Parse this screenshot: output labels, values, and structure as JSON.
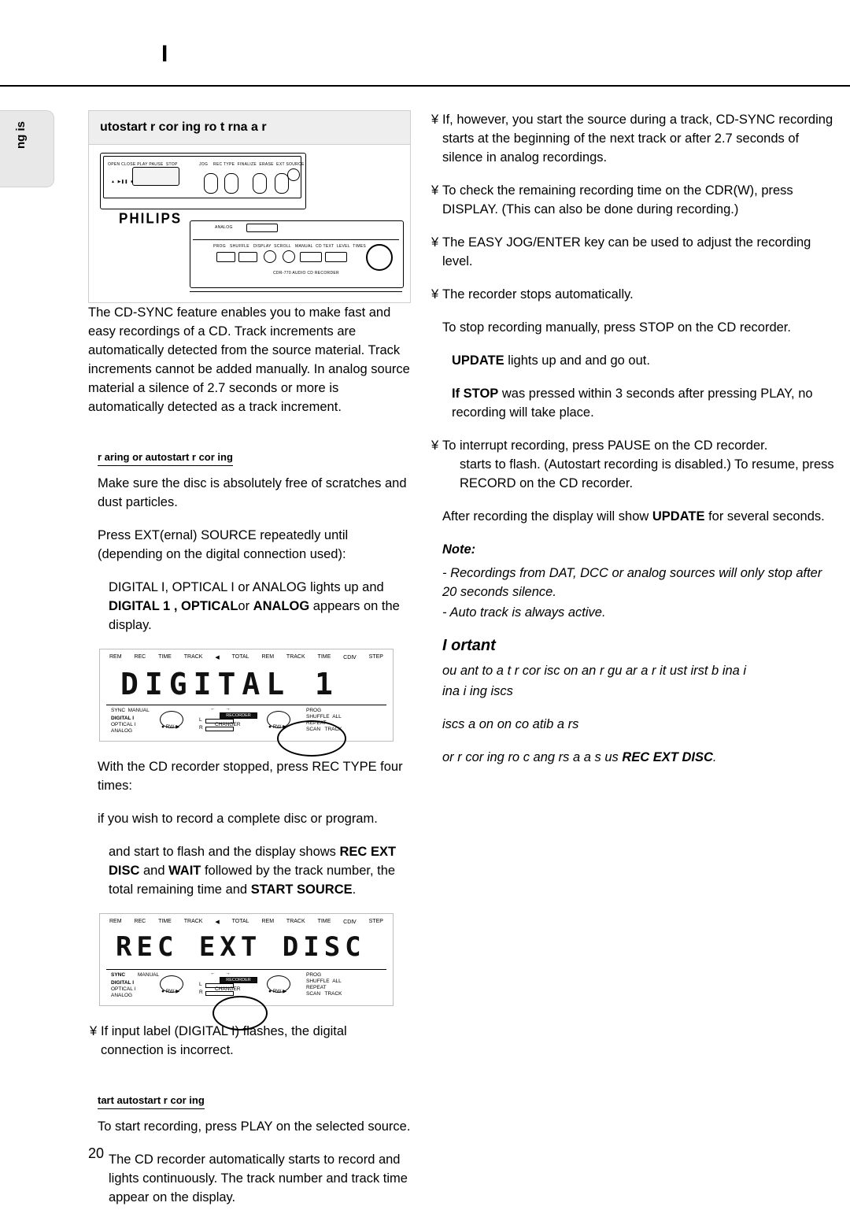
{
  "header": {
    "title": "I"
  },
  "side_tab": {
    "label": "ng  is"
  },
  "left": {
    "heading": "utostart r cor ing ro      t rna       a  r",
    "intro": "The CD-SYNC feature enables you to make fast and easy recordings of a CD. Track increments are automatically detected from the source material. Track increments cannot be added manually. In analog source material a silence of 2.7 seconds or more is automatically detected as a track increment.",
    "prepare_heading": "r aring  or autostart r cor ing",
    "prepare_p1": "Make sure the disc is absolutely free of scratches and dust particles.",
    "prepare_p2": "Press EXT(ernal) SOURCE repeatedly until (depending on the digital connection used):",
    "prepare_p3_a": "DIGITAL I, OPTICAL I or ANALOG lights up and ",
    "prepare_p3_b": "DIGITAL 1 , OPTICAL",
    "prepare_p3_c": "or ",
    "prepare_p3_d": "ANALOG",
    "prepare_p3_e": " appears on the display.",
    "lcd1": {
      "top_labels": [
        "REM",
        "REC",
        "TIME",
        "TRACK",
        "◀",
        "TOTAL",
        "REM",
        "TRACK",
        "TIME",
        "CDⅢ",
        "STEP"
      ],
      "segment": "DIGITAL 1",
      "left_labels": [
        "SYNC",
        "MANUAL",
        "DIGITAL I",
        "OPTICAL I",
        "ANALOG"
      ],
      "center_label": "CHANGER",
      "center_box": "RECORDER",
      "right_labels": [
        "PROG",
        "SHUFFLE",
        "ALL",
        "REPEAT",
        "SCAN",
        "TRACK"
      ],
      "rw_label": "RW ▶",
      "lr_labels": [
        "L",
        "R"
      ]
    },
    "rec_p1_a": "With the CD recorder stopped,  press REC TYPE  four times:",
    "rec_p2": "if you wish to record a complete disc or program.",
    "rec_p3_a": "and",
    "rec_p3_b": "start to flash and the display shows ",
    "rec_p3_c": "REC",
    "rec_p3_d": "EXT DISC",
    "rec_p3_e": " and ",
    "rec_p3_f": "WAIT",
    "rec_p3_g": " followed by the track number, the total remaining time and ",
    "rec_p3_h": "START SOURCE",
    "rec_p3_i": ".",
    "lcd2": {
      "top_labels": [
        "REM",
        "REC",
        "TIME",
        "TRACK",
        "◀",
        "TOTAL",
        "REM",
        "TRACK",
        "TIME",
        "CDⅢ",
        "STEP"
      ],
      "segment": "REC EXT DISC",
      "left_labels": [
        "SYNC",
        "MANUAL",
        "DIGITAL I",
        "OPTICAL I",
        "ANALOG"
      ],
      "center_label": "CHANGER",
      "center_box": "RECORDER",
      "right_labels": [
        "PROG",
        "SHUFFLE",
        "ALL",
        "REPEAT",
        "SCAN",
        "TRACK"
      ],
      "rw_label": "RW ▶",
      "lr_labels": [
        "L",
        "R"
      ]
    },
    "bullet_input": "If input label (DIGITAL I)  flashes, the digital connection is incorrect.",
    "start_heading": "tart autostart r cor ing",
    "start_p1": "To start recording,  press PLAY  on the selected source.",
    "start_p2": "The CD recorder automatically starts to record and lights continuously. The track number and track time appear on the display."
  },
  "right": {
    "b1": "If, however, you start the source during a track, CD-SYNC recording starts at the beginning of the next track or after 2.7 seconds of silence in analog recordings.",
    "b2": "To check the remaining recording time on the CDR(W), press DISPLAY. (This can also be done during recording.)",
    "b3": "The EASY JOG/ENTER key can be used to adjust the recording level.",
    "b4": "The recorder stops automatically.",
    "p1": "To stop recording manually, press STOP on the CD recorder.",
    "p2_a": "UPDATE",
    "p2_b": " lights up and",
    "p2_c": "and",
    "p2_d": "go out.",
    "p3_a": "If STOP",
    "p3_b": " was pressed within 3 seconds after pressing PLAY, no recording will take place.",
    "b5_a": "To interrupt recording, press PAUSE on the CD recorder.",
    "b5_b": "starts to flash. (Autostart recording is disabled.) To resume, press RECORD on the CD recorder.",
    "p4_a": "After recording the display will show ",
    "p4_b": "UPDATE",
    "p4_c": " for several seconds.",
    "note_heading": "Note:",
    "note_1": "- Recordings from DAT, DCC or analog sources will only stop after 20 seconds silence.",
    "note_2": "- Auto track is always active.",
    "imp_heading": "I  ortant",
    "imp_1": "   ou  ant to  a  t  r  cor              isc on an    r gu ar      a   r it  ust  irst b   ina i",
    "imp_2": " ina i ing  iscs",
    "imp_3_a": " iscs  a   on  on            co  atib      a  rs",
    "imp_4_a": "  or r cor ing  ro      c ang rs a   a s us ",
    "imp_4_b": "REC EXT DISC",
    "imp_4_c": "."
  },
  "footer": {
    "page_number": "20"
  }
}
